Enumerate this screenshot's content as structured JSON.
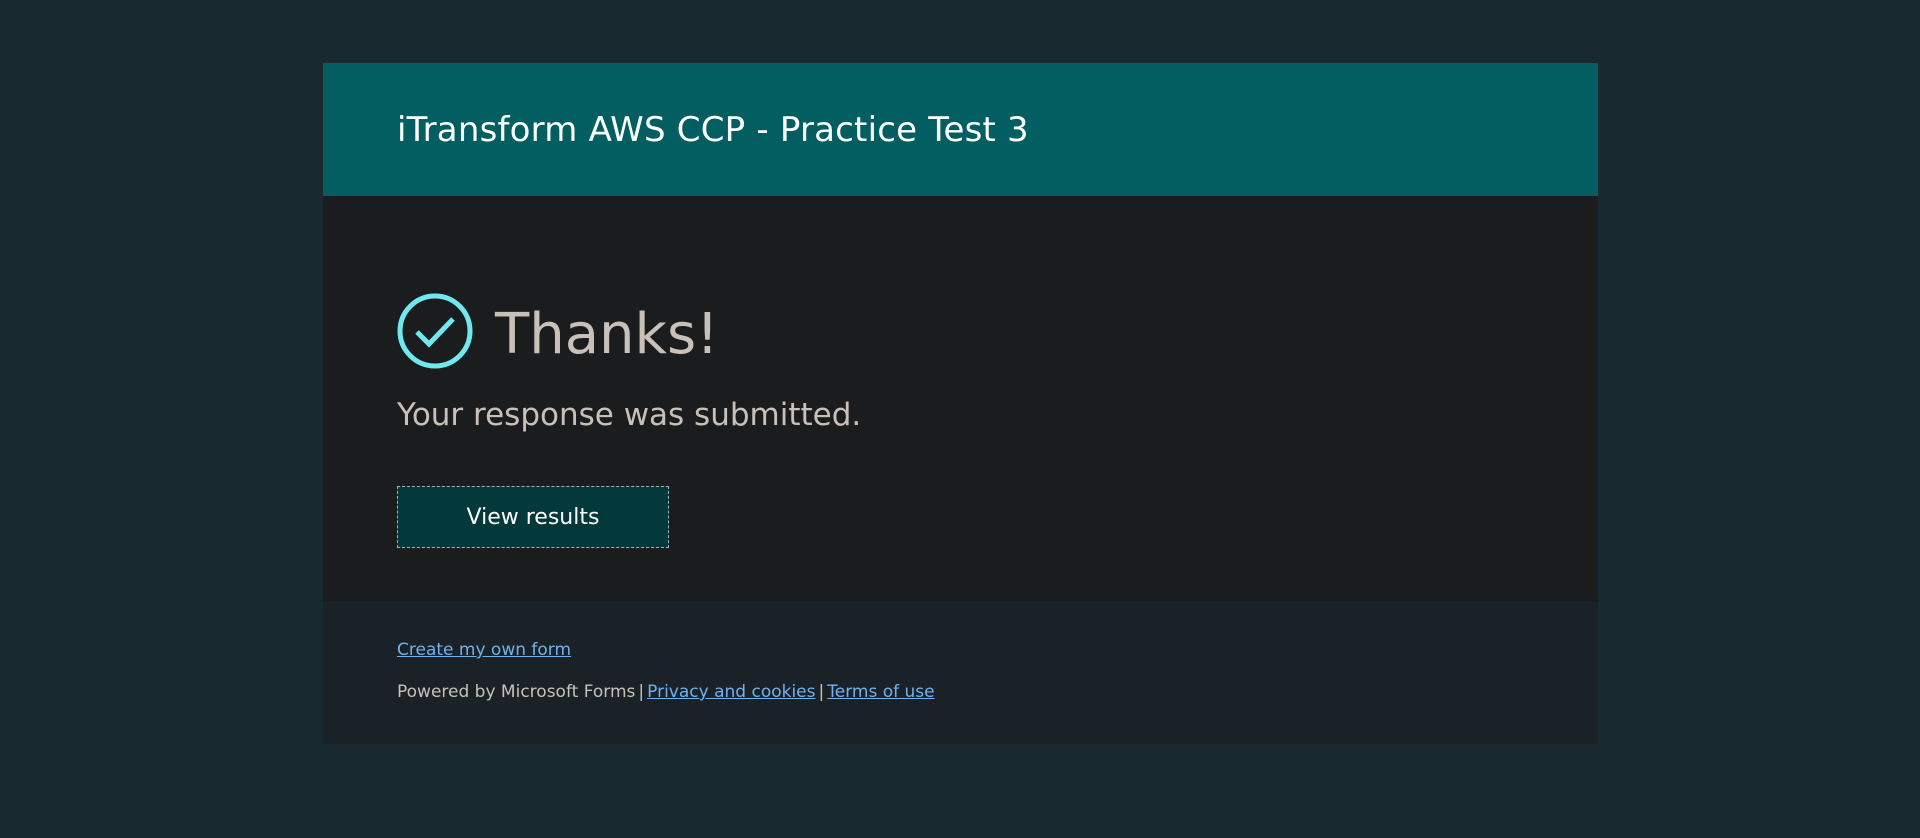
{
  "header": {
    "title": "iTransform AWS CCP - Practice Test 3"
  },
  "main": {
    "heading": "Thanks!",
    "message": "Your response was submitted.",
    "view_results_label": "View results",
    "icon": "checkmark-circle-icon"
  },
  "footer": {
    "create_form_link": "Create my own form",
    "powered_by": "Powered by Microsoft Forms",
    "separator": "|",
    "privacy_link": "Privacy and cookies",
    "terms_link": "Terms of use"
  },
  "colors": {
    "page_background": "#182a30",
    "header_background": "#025e61",
    "main_background": "#1b1c1e",
    "footer_background": "#1a2127",
    "check_accent": "#6fe8f0",
    "link": "#6fb2f0",
    "button_background": "#03393a"
  }
}
